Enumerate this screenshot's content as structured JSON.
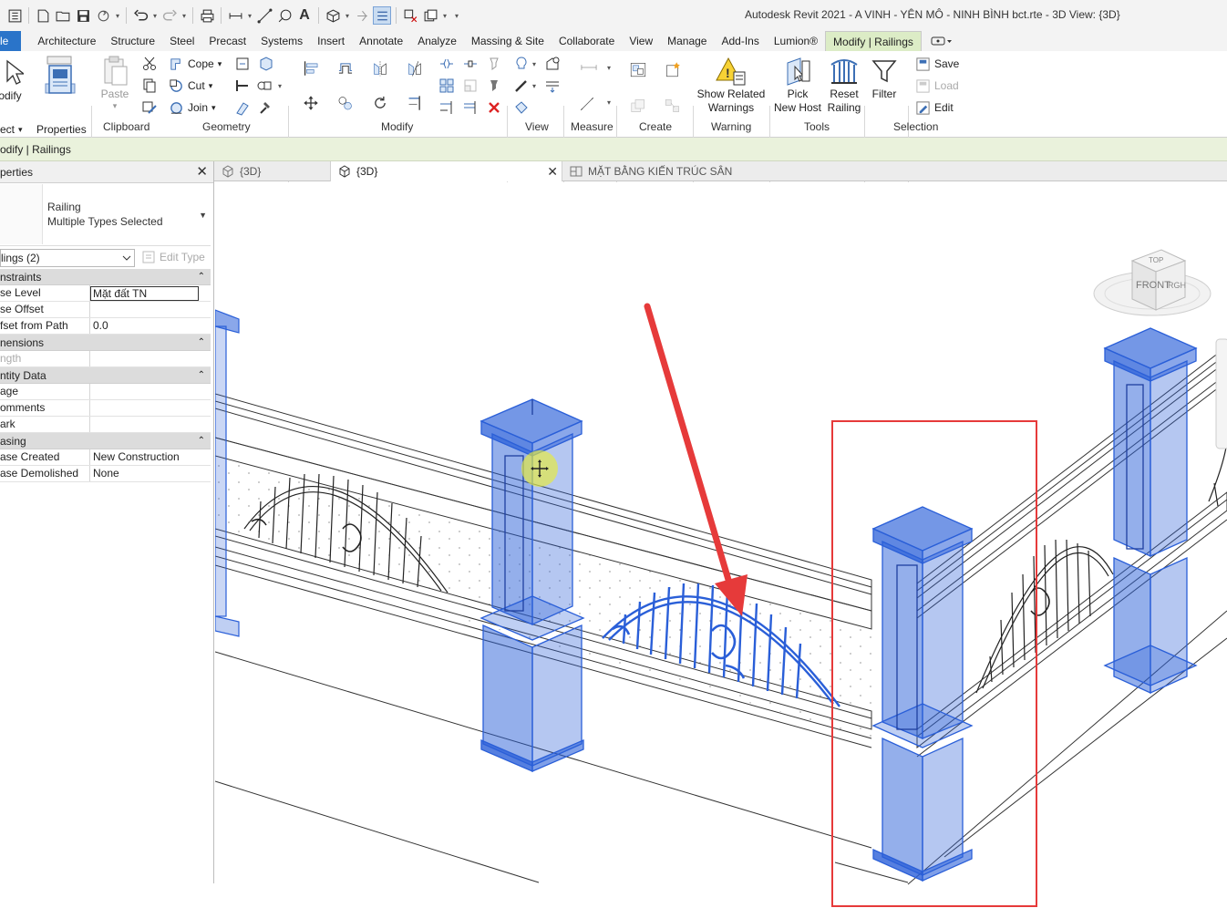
{
  "app": {
    "title": "Autodesk Revit 2021 - A VINH - YÊN MÔ - NINH BÌNH bct.rte - 3D View: {3D}"
  },
  "tabs": [
    "le",
    "Architecture",
    "Structure",
    "Steel",
    "Precast",
    "Systems",
    "Insert",
    "Annotate",
    "Analyze",
    "Massing & Site",
    "Collaborate",
    "View",
    "Manage",
    "Add-Ins",
    "Lumion®",
    "Modify | Railings"
  ],
  "ribbon": {
    "modify_label": "odify",
    "select_label": "ect",
    "properties_label": "Properties",
    "paste_label": "Paste",
    "cope_label": "Cope",
    "cut_label": "Cut",
    "join_label": "Join",
    "show_warnings_line1": "Show Related",
    "show_warnings_line2": "Warnings",
    "pick_host_line1": "Pick",
    "pick_host_line2": "New Host",
    "reset_line1": "Reset",
    "reset_line2": "Railing",
    "filter_label": "Filter",
    "save_label": "Save",
    "load_label": "Load",
    "edit_label": "Edit",
    "panels": {
      "clipboard": "Clipboard",
      "geometry": "Geometry",
      "modify": "Modify",
      "view": "View",
      "measure": "Measure",
      "create": "Create",
      "warning": "Warning",
      "tools": "Tools",
      "selection": "Selection"
    }
  },
  "context_bar": "odify | Railings",
  "properties": {
    "header": "perties",
    "type_line1": "Railing",
    "type_line2": "Multiple Types Selected",
    "instance": "lings (2)",
    "edit_type": "Edit Type",
    "groups": [
      {
        "name": "nstraints",
        "rows": [
          {
            "key": "se Level",
            "value": "Mặt đất TN"
          },
          {
            "key": "se Offset",
            "value": ""
          },
          {
            "key": "fset from Path",
            "value": "0.0"
          }
        ]
      },
      {
        "name": "nensions",
        "rows": [
          {
            "key": "ngth",
            "value": ""
          }
        ]
      },
      {
        "name": "ntity Data",
        "rows": [
          {
            "key": "age",
            "value": ""
          },
          {
            "key": "omments",
            "value": ""
          },
          {
            "key": "ark",
            "value": ""
          }
        ]
      },
      {
        "name": "asing",
        "rows": [
          {
            "key": "ase Created",
            "value": "New Construction"
          },
          {
            "key": "ase Demolished",
            "value": "None"
          }
        ]
      }
    ]
  },
  "view_tabs": [
    {
      "label": "{3D}",
      "active": false
    },
    {
      "label": "{3D}",
      "active": true
    },
    {
      "label": "MẶT BẰNG KIẾN TRÚC SÂN",
      "active": false
    }
  ],
  "viewcube": {
    "top": "TOP",
    "front": "FRONT",
    "right": "RGH"
  },
  "colors": {
    "selection": "#2a5fd8",
    "annotation": "#e63a3a",
    "file_tab": "#2a74c9",
    "context_tab": "#dcecc6"
  }
}
